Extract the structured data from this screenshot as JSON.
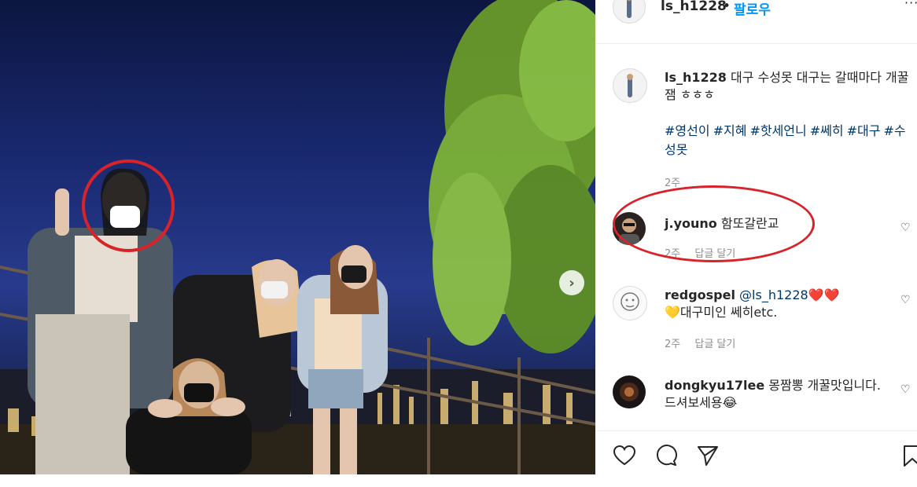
{
  "post": {
    "header": {
      "username": "ls_h1228",
      "separator": "•",
      "follow_label": "팔로우",
      "more_label": "···"
    },
    "caption": {
      "username": "ls_h1228",
      "text": "대구 수성못 대구는 갈때마다 개꿀잼 ㅎㅎㅎ"
    },
    "hashtags": [
      "#영선이",
      "#지혜",
      "#핫세언니",
      "#쎄히",
      "#대구",
      "#수성못"
    ],
    "time": "2주"
  },
  "comments": [
    {
      "username": "j.youno",
      "text": "함또갈란교",
      "time": "2주",
      "reply_label": "답글 달기",
      "like_icon": "heart-outline-icon"
    },
    {
      "username": "redgospel",
      "mention": "@ls_h1228",
      "emoji": "❤️❤️",
      "text_line2": "💛대구미인 쎄히etc.",
      "time": "2주",
      "reply_label": "답글 달기",
      "like_icon": "heart-outline-icon"
    },
    {
      "username": "dongkyu17lee",
      "text": "몽짬뽕 개꿀맛입니다. 드셔보세용😂",
      "like_icon": "heart-outline-icon"
    }
  ],
  "actions": [
    "heart-icon",
    "comment-icon",
    "share-icon",
    "bookmark-icon"
  ],
  "colors": {
    "highlight": "#d8232a",
    "link": "#00376b",
    "follow": "#0095f6",
    "meta": "#8e8e8e"
  }
}
